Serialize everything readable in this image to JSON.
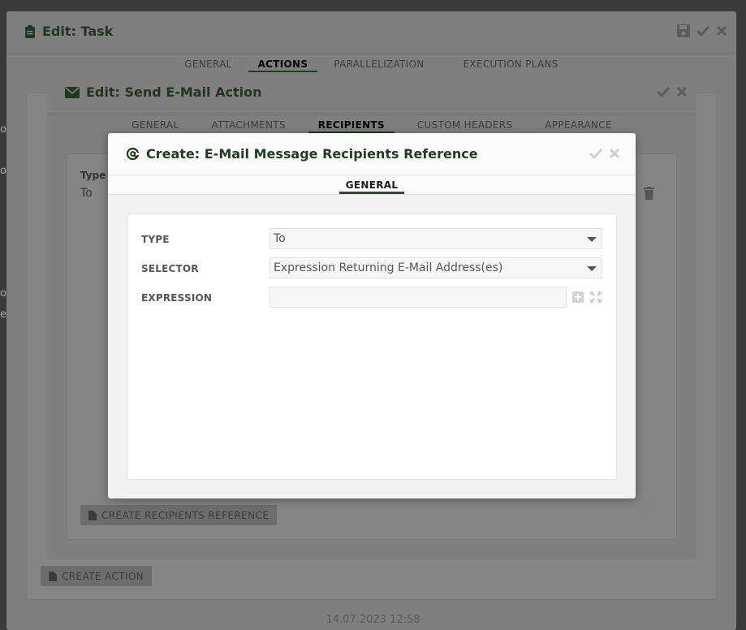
{
  "task_dialog": {
    "title": "Edit: Task",
    "tabs": [
      {
        "label": "GENERAL",
        "active": false
      },
      {
        "label": "ACTIONS",
        "active": true
      },
      {
        "label": "PARALLELIZATION",
        "active": false
      },
      {
        "label": "EXECUTION PLANS",
        "active": false
      }
    ],
    "create_action_label": "CREATE ACTION",
    "footer_timestamp": "14.07.2023 12:58"
  },
  "mail_dialog": {
    "title": "Edit: Send E-Mail Action",
    "tabs": [
      {
        "label": "GENERAL",
        "active": false
      },
      {
        "label": "ATTACHMENTS",
        "active": false
      },
      {
        "label": "RECIPIENTS",
        "active": true
      },
      {
        "label": "CUSTOM HEADERS",
        "active": false
      },
      {
        "label": "APPEARANCE",
        "active": false
      }
    ],
    "column_label": "Type",
    "row_value": "To",
    "create_recipients_label": "CREATE RECIPIENTS REFERENCE"
  },
  "create_dialog": {
    "title": "Create: E-Mail Message Recipients Reference",
    "tabs": [
      {
        "label": "GENERAL",
        "active": true
      }
    ],
    "form": {
      "type_label": "TYPE",
      "type_value": "To",
      "selector_label": "SELECTOR",
      "selector_value": "Expression Returning E-Mail Address(es)",
      "expression_label": "EXPRESSION",
      "expression_value": ""
    }
  },
  "colors": {
    "accent_green": "#1f3d1f",
    "overlay_gray": "#7f7f7f",
    "dialog_bg": "#f2f2f2"
  }
}
